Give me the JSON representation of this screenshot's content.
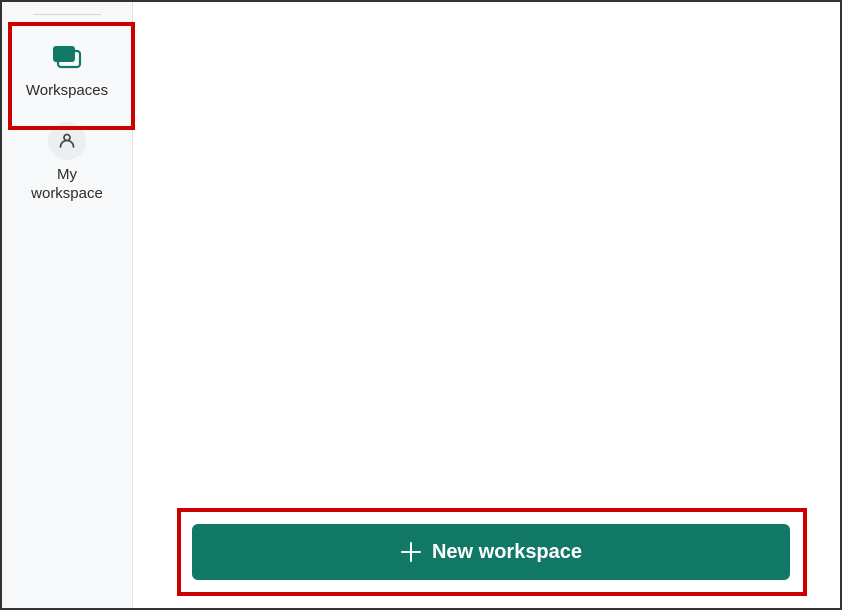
{
  "sidebar": {
    "items": [
      {
        "label": "Workspaces"
      },
      {
        "label": "My\nworkspace"
      }
    ]
  },
  "main": {
    "new_workspace_label": "New workspace"
  },
  "colors": {
    "accent": "#117865",
    "highlight": "#cc0000"
  }
}
